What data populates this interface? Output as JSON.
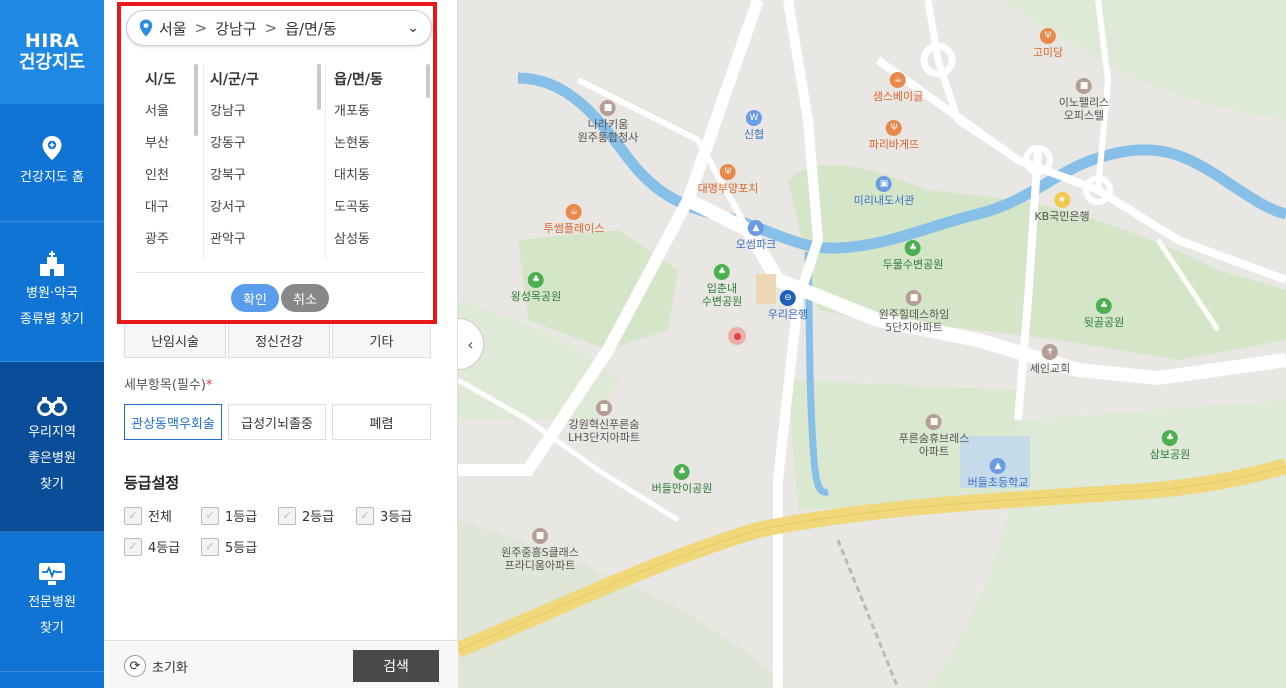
{
  "nav": {
    "logo_line1": "HIRA",
    "logo_line2": "건강지도",
    "items": [
      {
        "label_line1": "건강지도 홈",
        "label_line2": ""
      },
      {
        "label_line1": "병원·약국",
        "label_line2": "종류별 찾기"
      },
      {
        "label_line1": "우리지역",
        "label_line2": "좋은병원",
        "label_line3": "찾기"
      },
      {
        "label_line1": "전문병원",
        "label_line2": "찾기"
      }
    ]
  },
  "region_selector": {
    "breadcrumb": [
      "서울",
      "강남구",
      "읍/면/동"
    ],
    "columns": [
      {
        "header": "시/도",
        "items": [
          "서울",
          "부산",
          "인천",
          "대구",
          "광주"
        ]
      },
      {
        "header": "시/군/구",
        "items": [
          "강남구",
          "강동구",
          "강북구",
          "강서구",
          "관악구"
        ]
      },
      {
        "header": "읍/면/동",
        "items": [
          "개포동",
          "논현동",
          "대치동",
          "도곡동",
          "삼성동"
        ]
      }
    ],
    "confirm_label": "확인",
    "cancel_label": "취소"
  },
  "categories": [
    "난임시술",
    "정신건강",
    "기타"
  ],
  "detail": {
    "label": "세부항목(필수)",
    "required_mark": "*",
    "options": [
      "관상동맥우회술",
      "급성기뇌졸중",
      "폐렴"
    ],
    "selected": "관상동맥우회술"
  },
  "grade": {
    "title": "등급설정",
    "options": [
      "전체",
      "1등급",
      "2등급",
      "3등급",
      "4등급",
      "5등급"
    ]
  },
  "footer": {
    "reset_label": "초기화",
    "search_label": "검색"
  },
  "map": {
    "pois": [
      {
        "name": "나라키움\n원주통합청사",
        "kind": "gray"
      },
      {
        "name": "신협",
        "kind": "blue"
      },
      {
        "name": "대명부양포치",
        "kind": "orange"
      },
      {
        "name": "투썸플레이스",
        "kind": "orange"
      },
      {
        "name": "오썸파크",
        "kind": "blue"
      },
      {
        "name": "왕성목공원",
        "kind": "green"
      },
      {
        "name": "입춘내\n수변공원",
        "kind": "green"
      },
      {
        "name": "우리은행",
        "kind": "blue"
      },
      {
        "name": "샘스베이글",
        "kind": "orange"
      },
      {
        "name": "파리바게뜨",
        "kind": "orange"
      },
      {
        "name": "미리내도서관",
        "kind": "blue"
      },
      {
        "name": "두물수변공원",
        "kind": "green"
      },
      {
        "name": "원주힐데스하임\n5단지아파트",
        "kind": "gray"
      },
      {
        "name": "고미당",
        "kind": "orange"
      },
      {
        "name": "이노팰리스\n오피스텔",
        "kind": "gray"
      },
      {
        "name": "KB국민은행",
        "kind": "blue"
      },
      {
        "name": "뒷골공원",
        "kind": "green"
      },
      {
        "name": "세인교회",
        "kind": "gray"
      },
      {
        "name": "강원혁신푸른숨\nLH3단지아파트",
        "kind": "gray"
      },
      {
        "name": "푸른숨휴브레스\n아파트",
        "kind": "gray"
      },
      {
        "name": "버들초등학교",
        "kind": "blue"
      },
      {
        "name": "삼보공원",
        "kind": "green"
      },
      {
        "name": "버들만이공원",
        "kind": "green"
      },
      {
        "name": "원주중흥S클래스\n프라디움아파트",
        "kind": "gray"
      }
    ]
  },
  "colors": {
    "nav_bg": "#0f74d3",
    "nav_active": "#0a4d99",
    "highlight_outline": "#e8181a",
    "confirm": "#5b9ded",
    "river": "#7fb9e6",
    "park": "#cfe3c3"
  }
}
